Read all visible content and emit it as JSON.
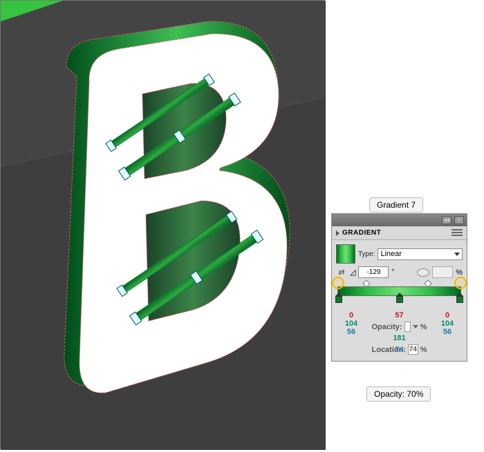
{
  "step_label": "Gradient 7",
  "opacity_label": "Opacity: 70%",
  "panel": {
    "title": "GRADIENT",
    "type_label": "Type:",
    "type_value": "Linear",
    "angle": "-129",
    "aspect_pct": "%",
    "opacity_label": "Opacity:",
    "opacity_unit": "%",
    "location_label": "Location:",
    "stops": {
      "left": {
        "r": "0",
        "g": "104",
        "b": "56",
        "location": "0"
      },
      "mid": {
        "r": "57",
        "g": "181",
        "b": "74",
        "location": "74"
      },
      "right": {
        "r": "0",
        "g": "104",
        "b": "56",
        "location": "100"
      }
    }
  }
}
